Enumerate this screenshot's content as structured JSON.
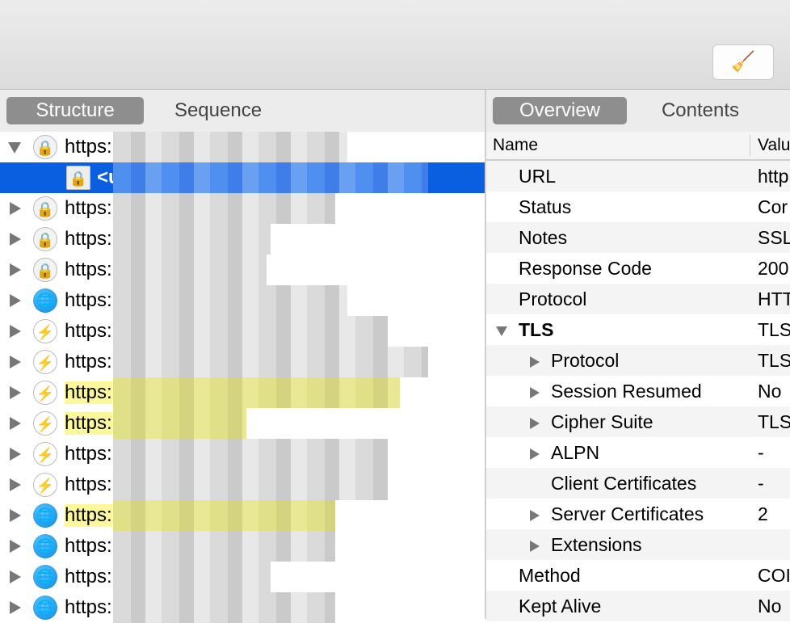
{
  "toolbar": {
    "clear_icon": "broom-icon"
  },
  "left_tabs": [
    {
      "label": "Structure",
      "selected": true
    },
    {
      "label": "Sequence",
      "selected": false
    }
  ],
  "right_tabs": [
    {
      "label": "Overview",
      "selected": true
    },
    {
      "label": "Contents",
      "selected": false
    }
  ],
  "tree": [
    {
      "label": "https:",
      "icon": "lock",
      "expanded": true,
      "highlight": false
    },
    {
      "label": "<u",
      "icon": "file-lock",
      "child": true,
      "selected": true
    },
    {
      "label": "https:",
      "icon": "lock"
    },
    {
      "label": "https:",
      "icon": "lock"
    },
    {
      "label": "https:",
      "icon": "lock"
    },
    {
      "label": "https:",
      "icon": "globe"
    },
    {
      "label": "https:",
      "icon": "bolt"
    },
    {
      "label": "https:",
      "icon": "bolt"
    },
    {
      "label": "https:",
      "icon": "bolt",
      "highlight": true
    },
    {
      "label": "https:",
      "icon": "bolt",
      "highlight": true
    },
    {
      "label": "https:",
      "icon": "bolt"
    },
    {
      "label": "https:",
      "icon": "bolt"
    },
    {
      "label": "https:",
      "icon": "globe",
      "highlight": true
    },
    {
      "label": "https:",
      "icon": "globe"
    },
    {
      "label": "https:",
      "icon": "globe"
    },
    {
      "label": "https:",
      "icon": "globe"
    }
  ],
  "overview": {
    "headers": {
      "name": "Name",
      "value": "Valu"
    },
    "rows": [
      {
        "name": "URL",
        "value": "http",
        "level": 0
      },
      {
        "name": "Status",
        "value": "Cor",
        "level": 0
      },
      {
        "name": "Notes",
        "value": "SSL",
        "level": 0
      },
      {
        "name": "Response Code",
        "value": "200",
        "level": 0
      },
      {
        "name": "Protocol",
        "value": "HTT",
        "level": 0
      },
      {
        "name": "TLS",
        "value": "TLS",
        "level": 0,
        "expander": "down",
        "bold": true
      },
      {
        "name": "Protocol",
        "value": "TLS",
        "level": 1,
        "expander": "right"
      },
      {
        "name": "Session Resumed",
        "value": "No",
        "level": 1,
        "expander": "right"
      },
      {
        "name": "Cipher Suite",
        "value": "TLS",
        "level": 1,
        "expander": "right"
      },
      {
        "name": "ALPN",
        "value": "-",
        "level": 1,
        "expander": "right"
      },
      {
        "name": "Client Certificates",
        "value": "-",
        "level": 1
      },
      {
        "name": "Server Certificates",
        "value": "2",
        "level": 1,
        "expander": "right"
      },
      {
        "name": "Extensions",
        "value": "",
        "level": 1,
        "expander": "right"
      },
      {
        "name": "Method",
        "value": "COI",
        "level": 0
      },
      {
        "name": "Kept Alive",
        "value": "No",
        "level": 0
      }
    ]
  }
}
